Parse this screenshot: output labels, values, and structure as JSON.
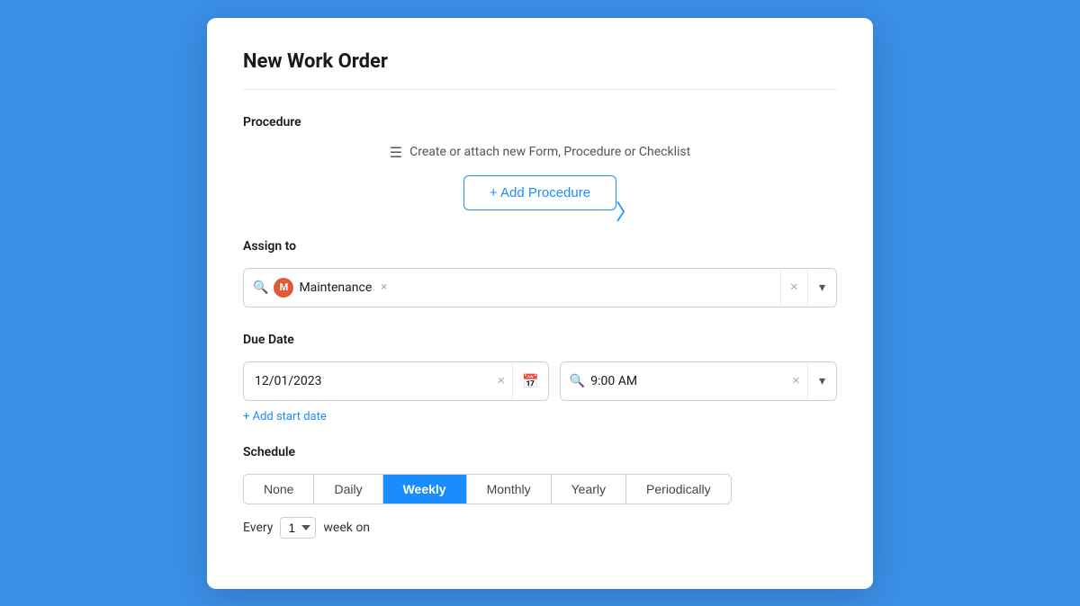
{
  "modal": {
    "title": "New Work Order"
  },
  "procedure": {
    "label": "Procedure",
    "hint": "Create or attach new Form, Procedure or Checklist",
    "add_button_label": "+ Add Procedure"
  },
  "assign_to": {
    "label": "Assign to",
    "search_placeholder": "",
    "assigned_user": "Maintenance",
    "assigned_user_initial": "M"
  },
  "due_date": {
    "label": "Due Date",
    "date_value": "12/01/2023",
    "time_value": "9:00 AM",
    "add_start_date_label": "+ Add start date"
  },
  "schedule": {
    "label": "Schedule",
    "tabs": [
      {
        "id": "none",
        "label": "None",
        "active": false
      },
      {
        "id": "daily",
        "label": "Daily",
        "active": false
      },
      {
        "id": "weekly",
        "label": "Weekly",
        "active": true
      },
      {
        "id": "monthly",
        "label": "Monthly",
        "active": false
      },
      {
        "id": "yearly",
        "label": "Yearly",
        "active": false
      },
      {
        "id": "periodically",
        "label": "Periodically",
        "active": false
      }
    ],
    "every_label": "Every",
    "every_value": "1",
    "week_on_label": "week on"
  }
}
